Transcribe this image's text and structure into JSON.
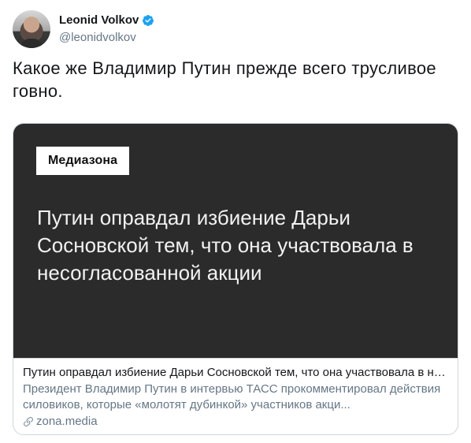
{
  "author": {
    "display_name": "Leonid Volkov",
    "handle": "@leonidvolkov",
    "verified": true
  },
  "tweet": {
    "text": "Какое же Владимир Путин прежде всего трусливое говно."
  },
  "card": {
    "logo_text": "Медиазона",
    "headline": "Путин оправдал избиение Дарьи Сосновской тем, что она участвовала в несогласованной акции",
    "title": "Путин оправдал избиение Дарьи Сосновской тем, что она участвовала в нес...",
    "description": "Президент Владимир Путин в интервью ТАСС прокомментировал действия силовиков, которые «молотят дубинкой» участников акци...",
    "domain": "zona.media"
  },
  "colors": {
    "verified_badge": "#1da1f2",
    "card_image_bg": "#2b2b2b",
    "secondary_text": "#657786",
    "border": "#ccd6dd"
  },
  "icons": [
    "verified-badge-icon",
    "link-icon"
  ]
}
